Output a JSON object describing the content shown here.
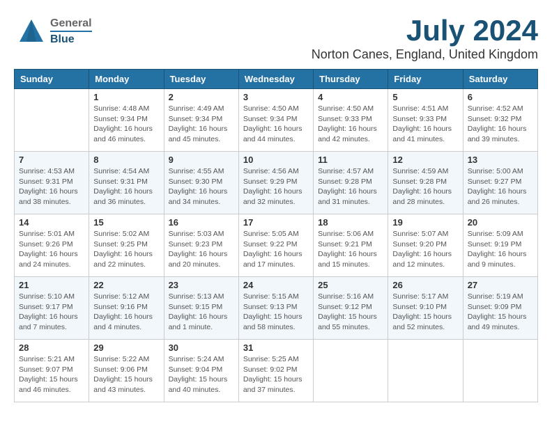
{
  "logo": {
    "general": "General",
    "blue": "Blue"
  },
  "title": {
    "month_year": "July 2024",
    "location": "Norton Canes, England, United Kingdom"
  },
  "weekdays": [
    "Sunday",
    "Monday",
    "Tuesday",
    "Wednesday",
    "Thursday",
    "Friday",
    "Saturday"
  ],
  "weeks": [
    [
      {
        "day": "",
        "info": ""
      },
      {
        "day": "1",
        "info": "Sunrise: 4:48 AM\nSunset: 9:34 PM\nDaylight: 16 hours\nand 46 minutes."
      },
      {
        "day": "2",
        "info": "Sunrise: 4:49 AM\nSunset: 9:34 PM\nDaylight: 16 hours\nand 45 minutes."
      },
      {
        "day": "3",
        "info": "Sunrise: 4:50 AM\nSunset: 9:34 PM\nDaylight: 16 hours\nand 44 minutes."
      },
      {
        "day": "4",
        "info": "Sunrise: 4:50 AM\nSunset: 9:33 PM\nDaylight: 16 hours\nand 42 minutes."
      },
      {
        "day": "5",
        "info": "Sunrise: 4:51 AM\nSunset: 9:33 PM\nDaylight: 16 hours\nand 41 minutes."
      },
      {
        "day": "6",
        "info": "Sunrise: 4:52 AM\nSunset: 9:32 PM\nDaylight: 16 hours\nand 39 minutes."
      }
    ],
    [
      {
        "day": "7",
        "info": "Sunrise: 4:53 AM\nSunset: 9:31 PM\nDaylight: 16 hours\nand 38 minutes."
      },
      {
        "day": "8",
        "info": "Sunrise: 4:54 AM\nSunset: 9:31 PM\nDaylight: 16 hours\nand 36 minutes."
      },
      {
        "day": "9",
        "info": "Sunrise: 4:55 AM\nSunset: 9:30 PM\nDaylight: 16 hours\nand 34 minutes."
      },
      {
        "day": "10",
        "info": "Sunrise: 4:56 AM\nSunset: 9:29 PM\nDaylight: 16 hours\nand 32 minutes."
      },
      {
        "day": "11",
        "info": "Sunrise: 4:57 AM\nSunset: 9:28 PM\nDaylight: 16 hours\nand 31 minutes."
      },
      {
        "day": "12",
        "info": "Sunrise: 4:59 AM\nSunset: 9:28 PM\nDaylight: 16 hours\nand 28 minutes."
      },
      {
        "day": "13",
        "info": "Sunrise: 5:00 AM\nSunset: 9:27 PM\nDaylight: 16 hours\nand 26 minutes."
      }
    ],
    [
      {
        "day": "14",
        "info": "Sunrise: 5:01 AM\nSunset: 9:26 PM\nDaylight: 16 hours\nand 24 minutes."
      },
      {
        "day": "15",
        "info": "Sunrise: 5:02 AM\nSunset: 9:25 PM\nDaylight: 16 hours\nand 22 minutes."
      },
      {
        "day": "16",
        "info": "Sunrise: 5:03 AM\nSunset: 9:23 PM\nDaylight: 16 hours\nand 20 minutes."
      },
      {
        "day": "17",
        "info": "Sunrise: 5:05 AM\nSunset: 9:22 PM\nDaylight: 16 hours\nand 17 minutes."
      },
      {
        "day": "18",
        "info": "Sunrise: 5:06 AM\nSunset: 9:21 PM\nDaylight: 16 hours\nand 15 minutes."
      },
      {
        "day": "19",
        "info": "Sunrise: 5:07 AM\nSunset: 9:20 PM\nDaylight: 16 hours\nand 12 minutes."
      },
      {
        "day": "20",
        "info": "Sunrise: 5:09 AM\nSunset: 9:19 PM\nDaylight: 16 hours\nand 9 minutes."
      }
    ],
    [
      {
        "day": "21",
        "info": "Sunrise: 5:10 AM\nSunset: 9:17 PM\nDaylight: 16 hours\nand 7 minutes."
      },
      {
        "day": "22",
        "info": "Sunrise: 5:12 AM\nSunset: 9:16 PM\nDaylight: 16 hours\nand 4 minutes."
      },
      {
        "day": "23",
        "info": "Sunrise: 5:13 AM\nSunset: 9:15 PM\nDaylight: 16 hours\nand 1 minute."
      },
      {
        "day": "24",
        "info": "Sunrise: 5:15 AM\nSunset: 9:13 PM\nDaylight: 15 hours\nand 58 minutes."
      },
      {
        "day": "25",
        "info": "Sunrise: 5:16 AM\nSunset: 9:12 PM\nDaylight: 15 hours\nand 55 minutes."
      },
      {
        "day": "26",
        "info": "Sunrise: 5:17 AM\nSunset: 9:10 PM\nDaylight: 15 hours\nand 52 minutes."
      },
      {
        "day": "27",
        "info": "Sunrise: 5:19 AM\nSunset: 9:09 PM\nDaylight: 15 hours\nand 49 minutes."
      }
    ],
    [
      {
        "day": "28",
        "info": "Sunrise: 5:21 AM\nSunset: 9:07 PM\nDaylight: 15 hours\nand 46 minutes."
      },
      {
        "day": "29",
        "info": "Sunrise: 5:22 AM\nSunset: 9:06 PM\nDaylight: 15 hours\nand 43 minutes."
      },
      {
        "day": "30",
        "info": "Sunrise: 5:24 AM\nSunset: 9:04 PM\nDaylight: 15 hours\nand 40 minutes."
      },
      {
        "day": "31",
        "info": "Sunrise: 5:25 AM\nSunset: 9:02 PM\nDaylight: 15 hours\nand 37 minutes."
      },
      {
        "day": "",
        "info": ""
      },
      {
        "day": "",
        "info": ""
      },
      {
        "day": "",
        "info": ""
      }
    ]
  ]
}
